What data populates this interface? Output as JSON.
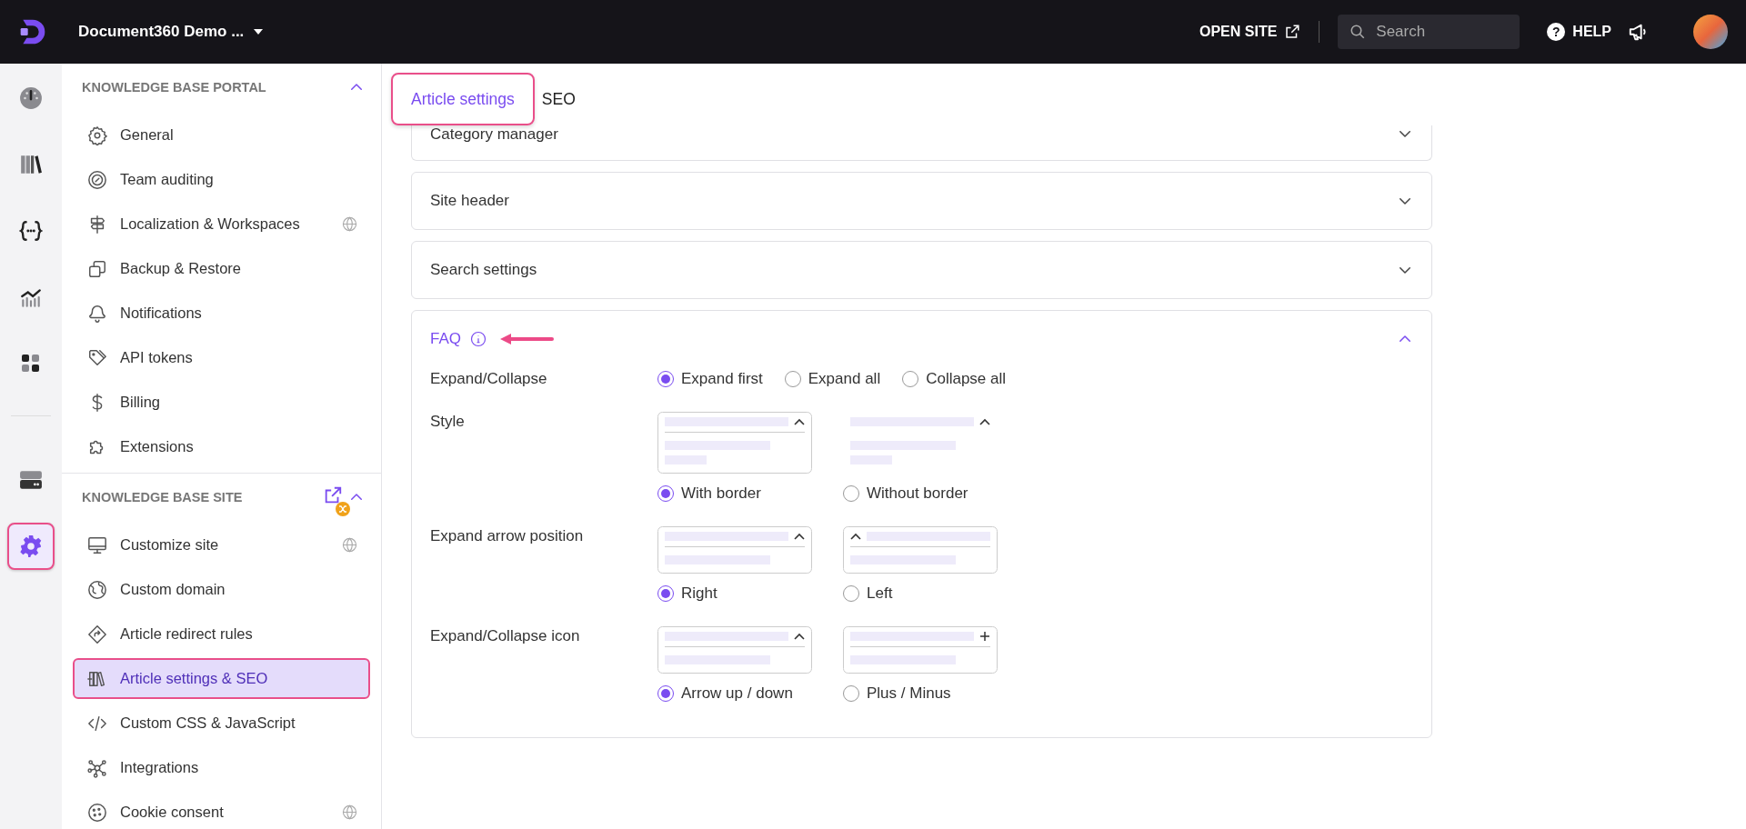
{
  "topbar": {
    "workspace": "Document360 Demo ...",
    "open_site": "OPEN SITE",
    "search": {
      "placeholder": "Search"
    },
    "help": {
      "glyph": "?",
      "label": "HELP"
    }
  },
  "rail": [
    {
      "selected": false
    },
    {
      "selected": false
    },
    {
      "selected": false
    },
    {
      "selected": false
    },
    {
      "selected": false
    },
    {
      "selected": false
    },
    {
      "selected": true
    }
  ],
  "sidebar": {
    "sections": [
      {
        "title": "KNOWLEDGE BASE PORTAL",
        "expanded": true,
        "link": false,
        "items": [
          {
            "label": "General",
            "globe": false,
            "selected": false
          },
          {
            "label": "Team auditing",
            "globe": false,
            "selected": false
          },
          {
            "label": "Localization & Workspaces",
            "globe": true,
            "selected": false
          },
          {
            "label": "Backup & Restore",
            "globe": false,
            "selected": false
          },
          {
            "label": "Notifications",
            "globe": false,
            "selected": false
          },
          {
            "label": "API tokens",
            "globe": false,
            "selected": false
          },
          {
            "label": "Billing",
            "globe": false,
            "selected": false
          },
          {
            "label": "Extensions",
            "globe": false,
            "selected": false
          }
        ]
      },
      {
        "title": "KNOWLEDGE BASE SITE",
        "expanded": true,
        "link": true,
        "items": [
          {
            "label": "Customize site",
            "globe": true,
            "selected": false
          },
          {
            "label": "Custom domain",
            "globe": false,
            "selected": false
          },
          {
            "label": "Article redirect rules",
            "globe": false,
            "selected": false
          },
          {
            "label": "Article settings & SEO",
            "globe": false,
            "selected": true
          },
          {
            "label": "Custom CSS & JavaScript",
            "globe": false,
            "selected": false
          },
          {
            "label": "Integrations",
            "globe": false,
            "selected": false
          },
          {
            "label": "Cookie consent",
            "globe": true,
            "selected": false
          }
        ]
      }
    ]
  },
  "tabs": [
    {
      "label": "Article settings",
      "selected": true
    },
    {
      "label": "SEO",
      "selected": false
    }
  ],
  "cards": [
    {
      "title": "Category manager",
      "expanded": false,
      "info": false
    },
    {
      "title": "Site header",
      "expanded": false,
      "info": false
    },
    {
      "title": "Search settings",
      "expanded": false,
      "info": false
    },
    {
      "title": "FAQ",
      "expanded": true,
      "info": true,
      "rows": [
        {
          "label": "Expand/Collapse",
          "kind": "radios",
          "options": [
            {
              "label": "Expand first",
              "selected": true
            },
            {
              "label": "Expand all",
              "selected": false
            },
            {
              "label": "Collapse all",
              "selected": false
            }
          ]
        },
        {
          "label": "Style",
          "kind": "previews",
          "options": [
            {
              "label": "With border",
              "selected": true
            },
            {
              "label": "Without border",
              "selected": false
            }
          ]
        },
        {
          "label": "Expand arrow position",
          "kind": "previews",
          "options": [
            {
              "label": "Right",
              "selected": true
            },
            {
              "label": "Left",
              "selected": false
            }
          ]
        },
        {
          "label": "Expand/Collapse icon",
          "kind": "previews",
          "options": [
            {
              "label": "Arrow up / down",
              "selected": true
            },
            {
              "label": "Plus / Minus",
              "selected": false
            }
          ]
        }
      ]
    }
  ]
}
